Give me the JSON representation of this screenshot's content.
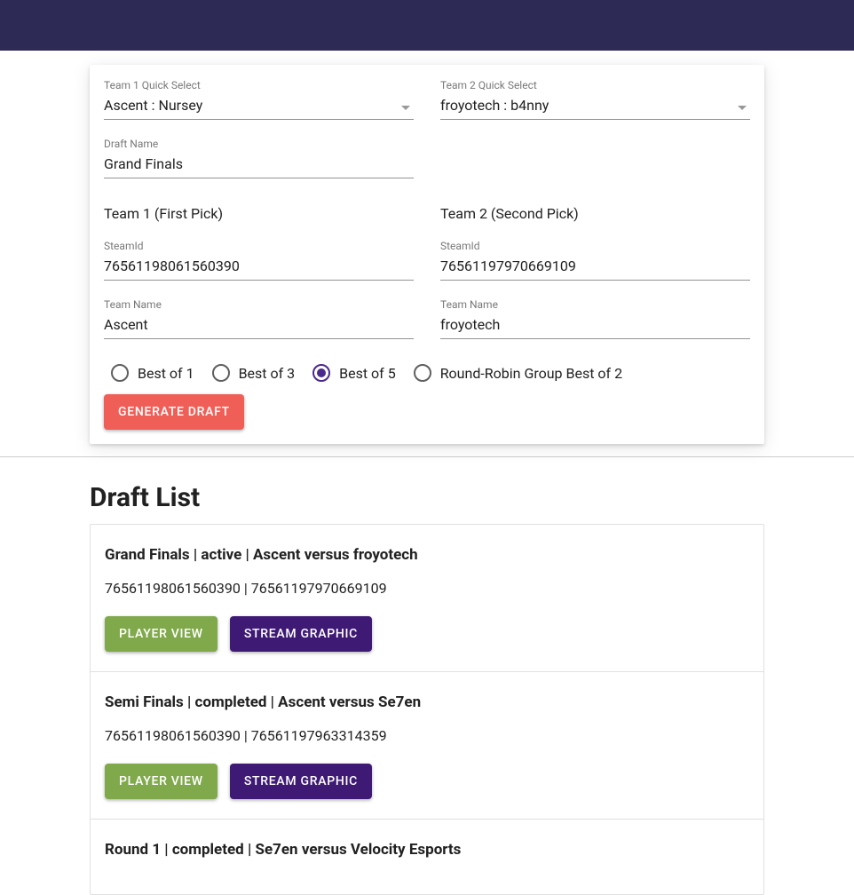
{
  "form": {
    "team1QuickSelect": {
      "label": "Team 1 Quick Select",
      "value": "Ascent : Nursey"
    },
    "team2QuickSelect": {
      "label": "Team 2 Quick Select",
      "value": "froyotech : b4nny"
    },
    "draftName": {
      "label": "Draft Name",
      "value": "Grand Finals"
    },
    "team1Heading": "Team 1 (First Pick)",
    "team2Heading": "Team 2 (Second Pick)",
    "team1Steam": {
      "label": "SteamId",
      "value": "76561198061560390"
    },
    "team2Steam": {
      "label": "SteamId",
      "value": "76561197970669109"
    },
    "team1Name": {
      "label": "Team Name",
      "value": "Ascent"
    },
    "team2Name": {
      "label": "Team Name",
      "value": "froyotech"
    },
    "formats": [
      "Best of 1",
      "Best of 3",
      "Best of 5",
      "Round-Robin Group Best of 2"
    ],
    "selectedFormat": 2,
    "generateLabel": "GENERATE DRAFT"
  },
  "listHeading": "Draft List",
  "buttons": {
    "playerView": "PLAYER VIEW",
    "streamGraphic": "STREAM GRAPHIC"
  },
  "drafts": [
    {
      "title": "Grand Finals | active | Ascent versus froyotech",
      "ids": "76561198061560390 | 76561197970669109"
    },
    {
      "title": "Semi Finals | completed | Ascent versus Se7en",
      "ids": "76561198061560390 | 76561197963314359"
    },
    {
      "title": "Round 1 | completed | Se7en versus Velocity Esports",
      "ids": ""
    }
  ]
}
